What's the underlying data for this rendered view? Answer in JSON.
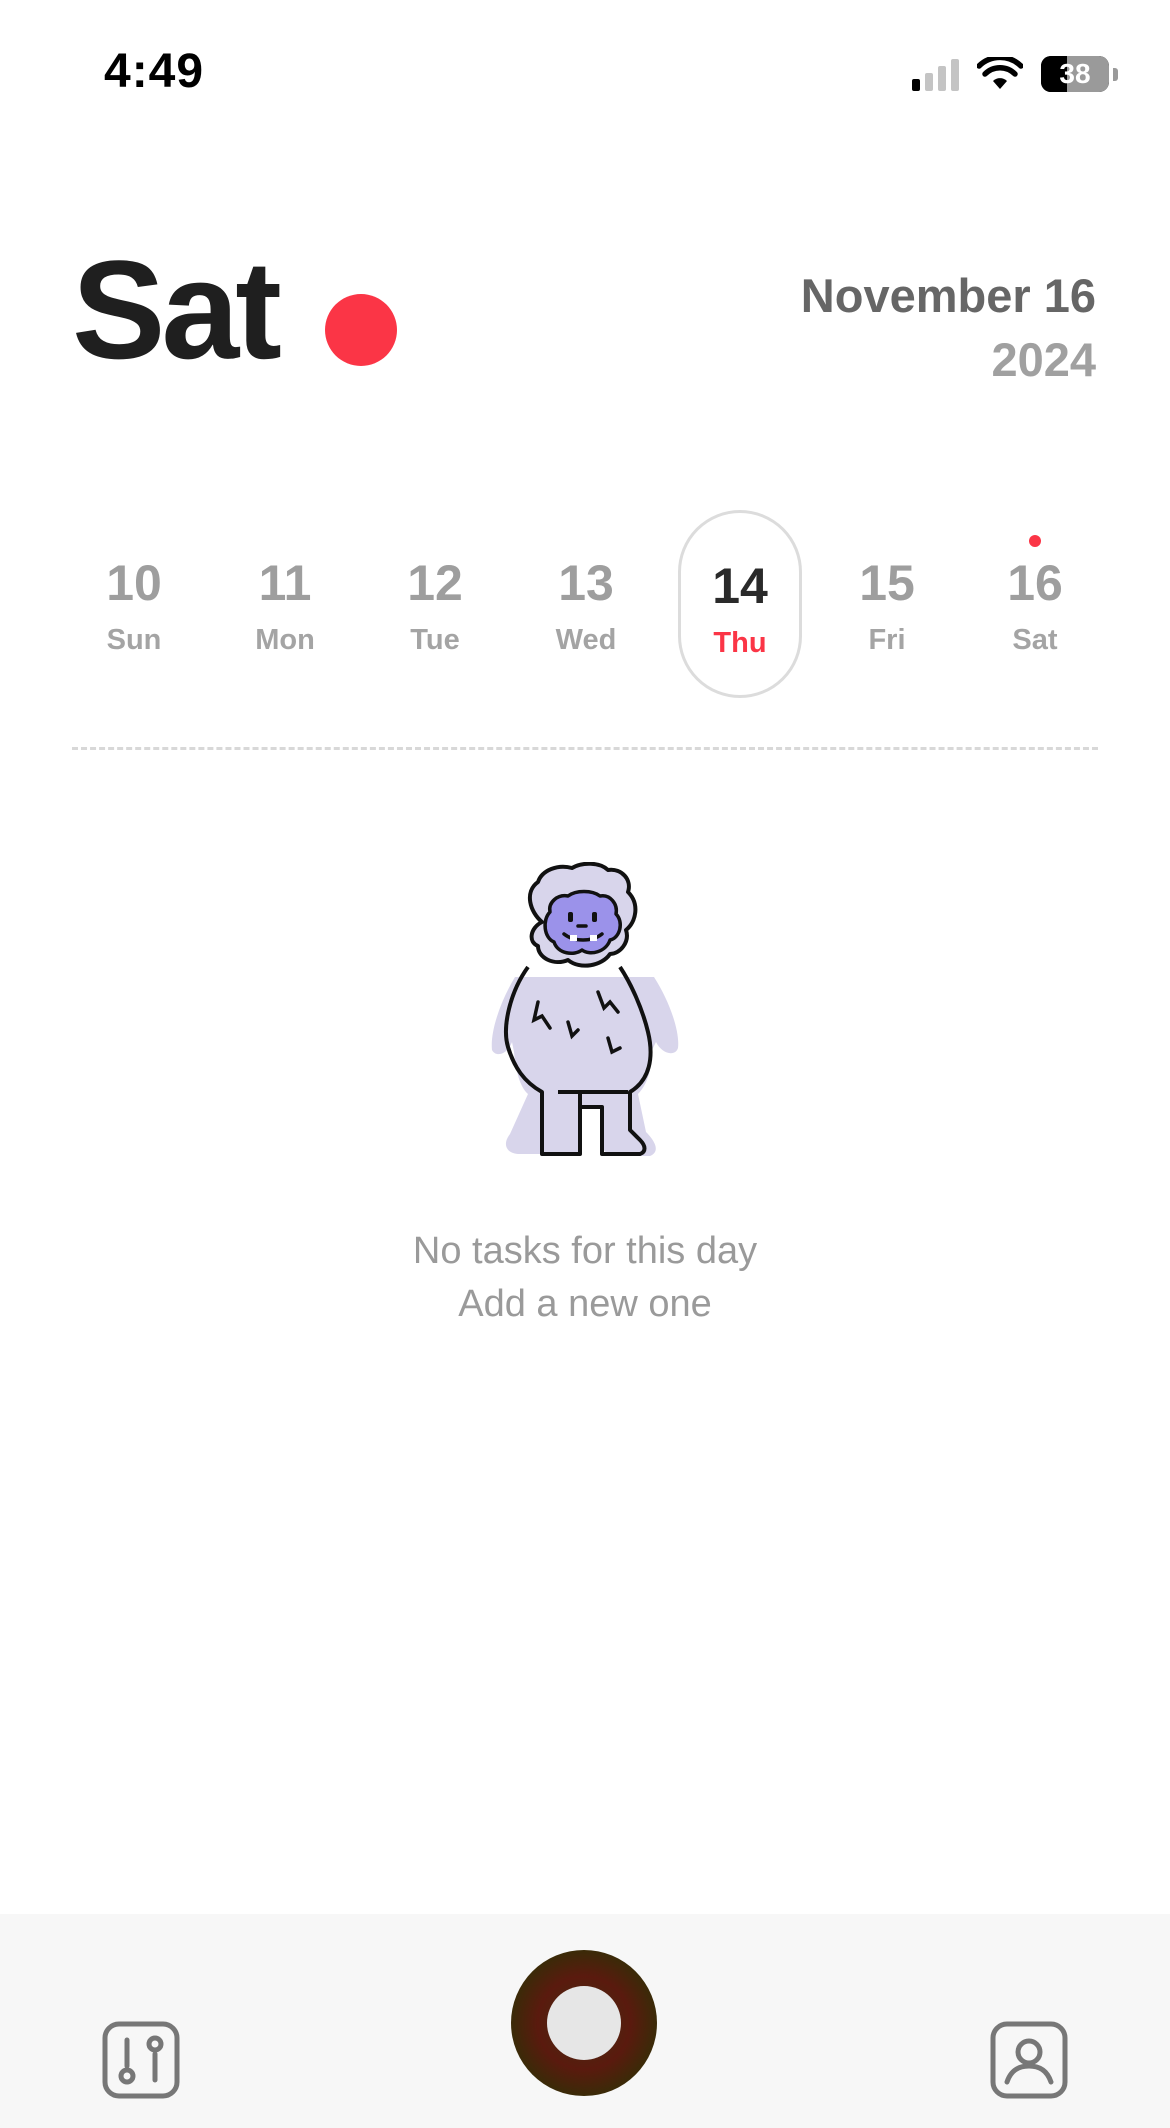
{
  "status_bar": {
    "time": "4:49",
    "battery": "38",
    "battery_level": 0.38,
    "signal_bars_active": 1,
    "signal_bars_total": 4
  },
  "header": {
    "day": "Sat",
    "month_day": "November 16",
    "year": "2024",
    "accent_color": "#fb3546"
  },
  "week": {
    "days": [
      {
        "num": "10",
        "name": "Sun"
      },
      {
        "num": "11",
        "name": "Mon"
      },
      {
        "num": "12",
        "name": "Tue"
      },
      {
        "num": "13",
        "name": "Wed"
      },
      {
        "num": "14",
        "name": "Thu",
        "selected": true
      },
      {
        "num": "15",
        "name": "Fri"
      },
      {
        "num": "16",
        "name": "Sat",
        "today": true
      }
    ]
  },
  "empty_state": {
    "line1": "No tasks for this day",
    "line2": "Add a new one",
    "illustration": "yeti-mascot"
  },
  "bottom_bar": {
    "left_icon": "settings-sliders-icon",
    "center": "record-button",
    "right_icon": "profile-icon"
  }
}
